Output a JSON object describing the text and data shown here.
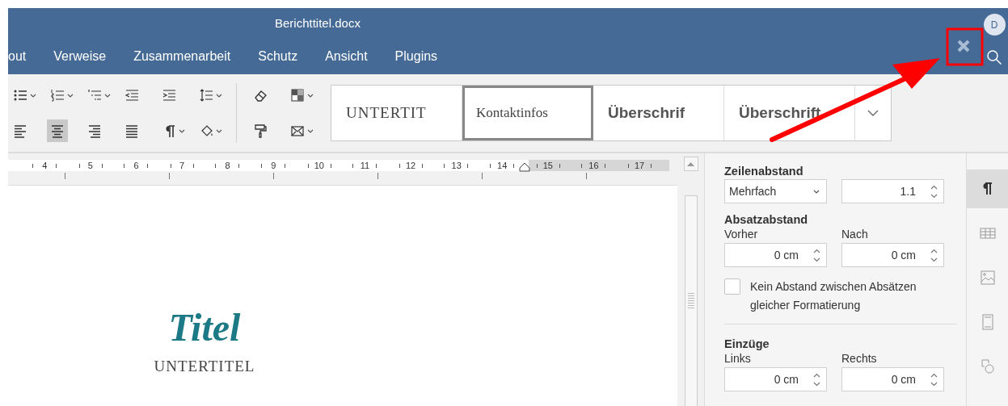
{
  "window": {
    "title": "Berichttitel.docx",
    "user_initial": "D"
  },
  "menu_tabs": [
    {
      "label": "out",
      "selected": false
    },
    {
      "label": "Verweise",
      "selected": false
    },
    {
      "label": "Zusammenarbeit",
      "selected": false
    },
    {
      "label": "Schutz",
      "selected": false
    },
    {
      "label": "Ansicht",
      "selected": false
    },
    {
      "label": "Plugins",
      "selected": false
    }
  ],
  "toolbar": {
    "alignment_buttons": [
      {
        "kind": "left",
        "selected": false
      },
      {
        "kind": "center",
        "selected": true
      },
      {
        "kind": "right",
        "selected": false
      },
      {
        "kind": "justify",
        "selected": false
      }
    ]
  },
  "style_gallery": [
    {
      "label": "UNTERTIT",
      "kind": "subtitle",
      "selected": false
    },
    {
      "label": "Kontaktinfos",
      "kind": "contact",
      "selected": true
    },
    {
      "label": "Überschrif",
      "kind": "heading",
      "selected": false
    },
    {
      "label": "Überschrift",
      "kind": "heading",
      "selected": false
    }
  ],
  "ruler": {
    "labels": [
      "4",
      "5",
      "6",
      "7",
      "8",
      "9",
      "10",
      "11",
      "12",
      "13",
      "14",
      "15",
      "16",
      "17"
    ]
  },
  "document": {
    "title": "Titel",
    "subtitle": "UNTERTITEL"
  },
  "paragraph_panel": {
    "line_spacing": {
      "heading": "Zeilenabstand",
      "mode": "Mehrfach",
      "value": "1.1"
    },
    "paragraph_spacing": {
      "heading": "Absatzabstand",
      "before_label": "Vorher",
      "before": "0 cm",
      "after_label": "Nach",
      "after": "0 cm"
    },
    "no_space_checkbox": {
      "label": "Kein Abstand zwischen Absätzen gleicher Formatierung",
      "checked": false
    },
    "indents": {
      "heading": "Einzüge",
      "left_label": "Links",
      "left": "0 cm",
      "right_label": "Rechts",
      "right": "0 cm"
    }
  },
  "right_sidebar": [
    {
      "kind": "paragraph",
      "selected": true
    },
    {
      "kind": "table",
      "selected": false
    },
    {
      "kind": "image",
      "selected": false
    },
    {
      "kind": "header_footer",
      "selected": false
    },
    {
      "kind": "shape",
      "selected": false
    }
  ],
  "annotation": {
    "kind": "arrow_to_box"
  }
}
